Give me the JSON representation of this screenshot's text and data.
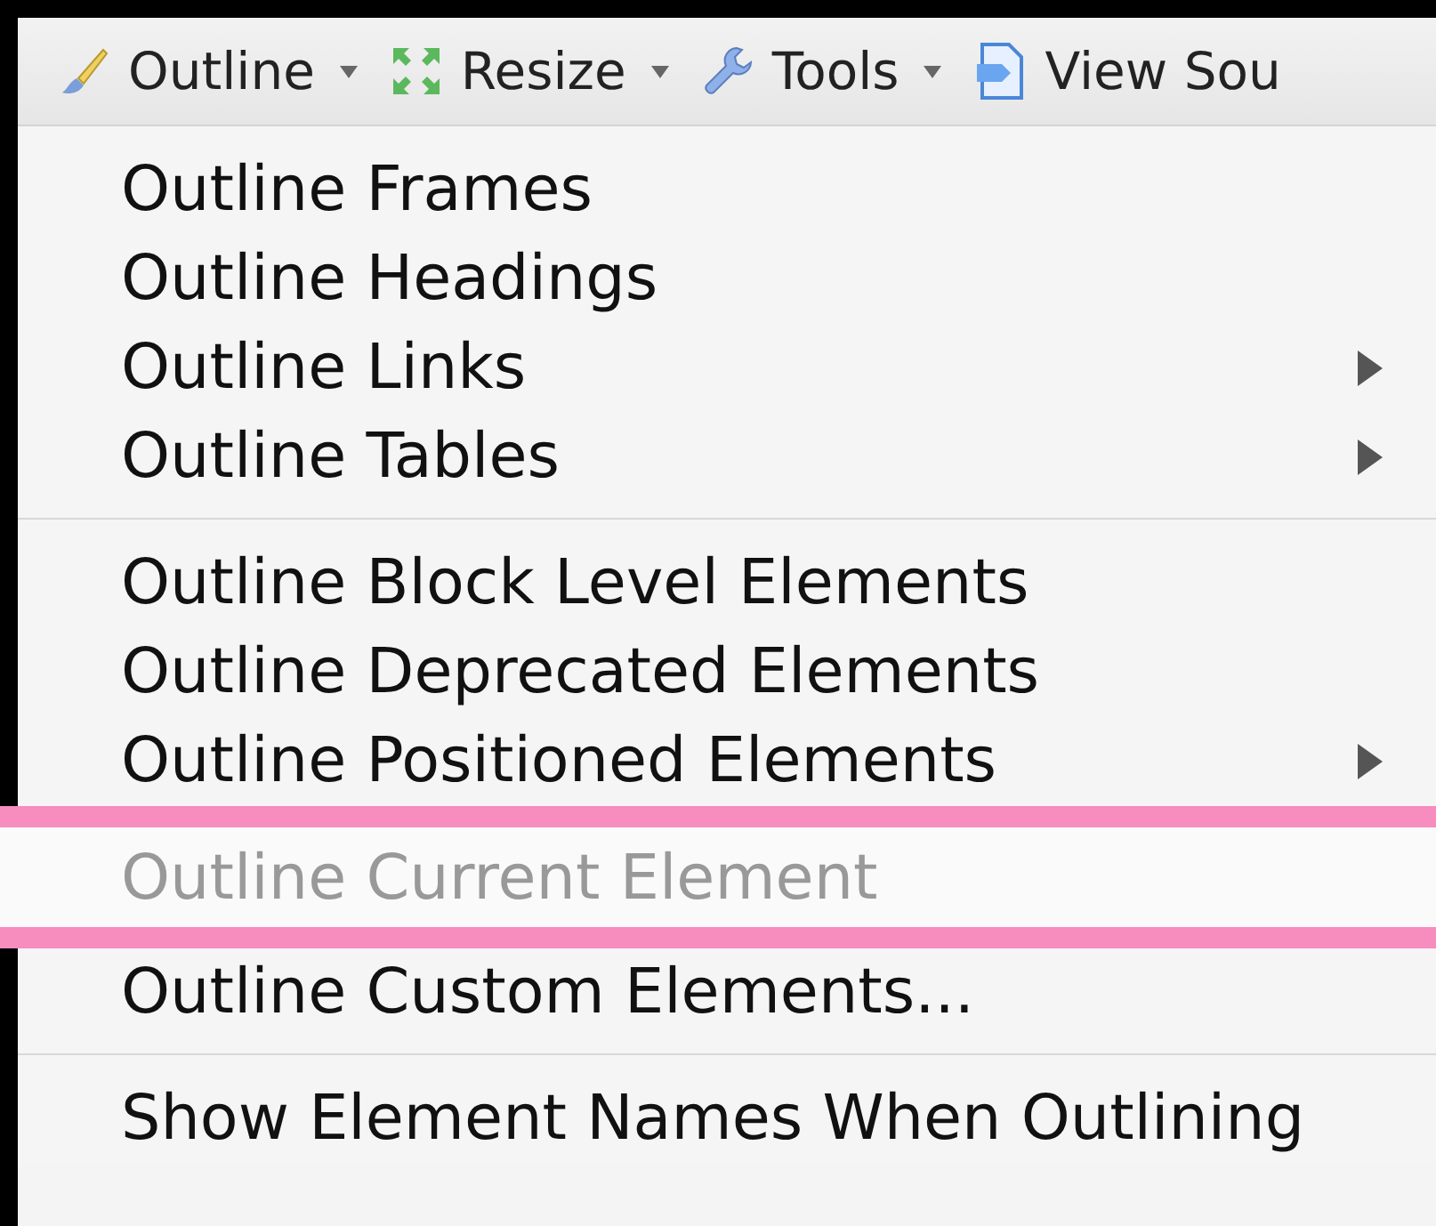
{
  "toolbar": [
    {
      "kind": "brush",
      "label": "Outline",
      "dropdown": true
    },
    {
      "kind": "resize",
      "label": "Resize",
      "dropdown": true
    },
    {
      "kind": "wrench",
      "label": "Tools",
      "dropdown": true
    },
    {
      "kind": "source",
      "label": "View Sou",
      "dropdown": false
    }
  ],
  "menu": {
    "sections": [
      [
        {
          "label": "Outline Frames",
          "submenu": false,
          "disabled": false,
          "highlighted": false
        },
        {
          "label": "Outline Headings",
          "submenu": false,
          "disabled": false,
          "highlighted": false
        },
        {
          "label": "Outline Links",
          "submenu": true,
          "disabled": false,
          "highlighted": false
        },
        {
          "label": "Outline Tables",
          "submenu": true,
          "disabled": false,
          "highlighted": false
        }
      ],
      [
        {
          "label": "Outline Block Level Elements",
          "submenu": false,
          "disabled": false,
          "highlighted": false
        },
        {
          "label": "Outline Deprecated Elements",
          "submenu": false,
          "disabled": false,
          "highlighted": false
        },
        {
          "label": "Outline Positioned Elements",
          "submenu": true,
          "disabled": false,
          "highlighted": false
        },
        {
          "label": "Outline Current Element",
          "submenu": false,
          "disabled": true,
          "highlighted": true
        },
        {
          "label": "Outline Custom Elements...",
          "submenu": false,
          "disabled": false,
          "highlighted": false
        }
      ],
      [
        {
          "label": "Show Element Names When Outlining",
          "submenu": false,
          "disabled": false,
          "highlighted": false
        }
      ]
    ]
  }
}
